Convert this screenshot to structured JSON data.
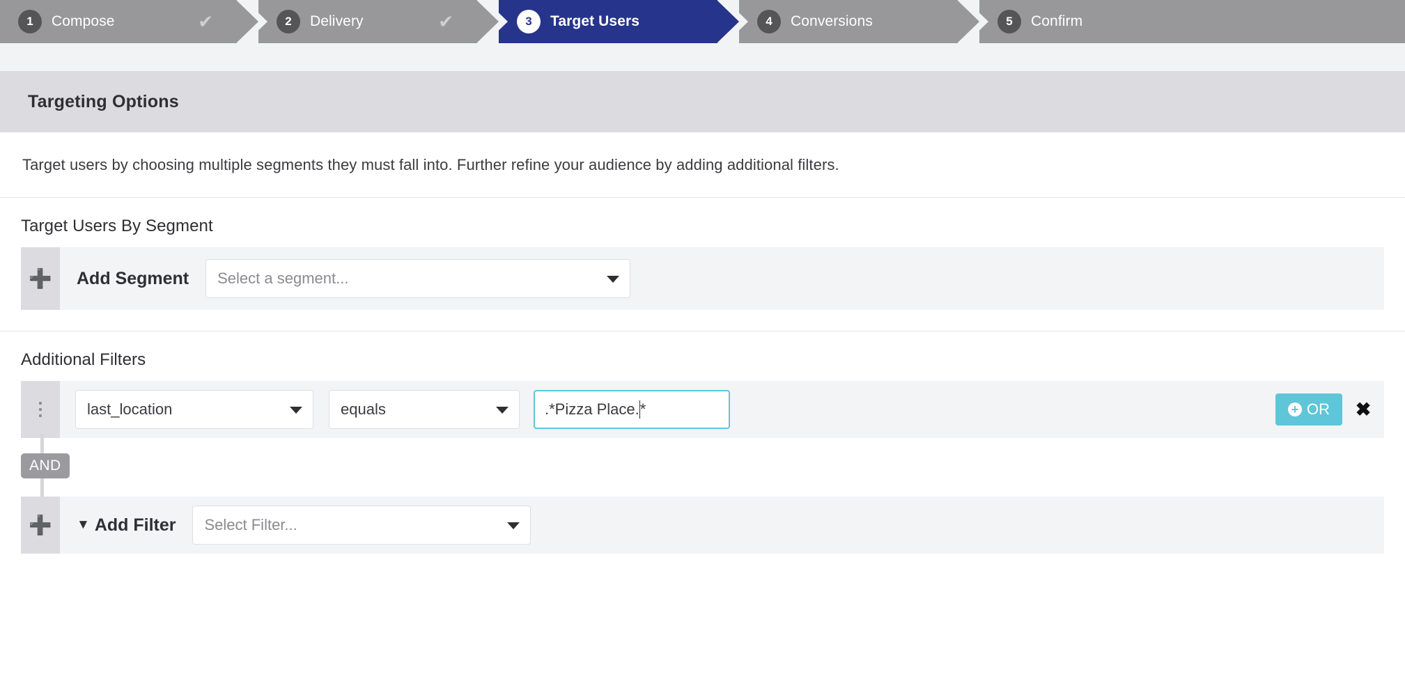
{
  "stepper": {
    "steps": [
      {
        "number": "1",
        "label": "Compose",
        "state": "complete",
        "check": "✔"
      },
      {
        "number": "2",
        "label": "Delivery",
        "state": "complete",
        "check": "✔"
      },
      {
        "number": "3",
        "label": "Target Users",
        "state": "active",
        "check": ""
      },
      {
        "number": "4",
        "label": "Conversions",
        "state": "upcoming",
        "check": ""
      },
      {
        "number": "5",
        "label": "Confirm",
        "state": "upcoming",
        "check": ""
      }
    ]
  },
  "panel": {
    "header_title": "Targeting Options",
    "description": "Target users by choosing multiple segments they must fall into. Further refine your audience by adding additional filters."
  },
  "segment_section": {
    "title": "Target Users By Segment",
    "add_label": "Add Segment",
    "add_icon": "plus-icon",
    "select_placeholder": "Select a segment...",
    "select_value": ""
  },
  "filters_section": {
    "title": "Additional Filters",
    "rows": [
      {
        "handle_icon": "drag-handle-icon",
        "attribute": "last_location",
        "operator": "equals",
        "value": ".*Pizza Place.",
        "value_tail": "*",
        "or_label": "OR",
        "or_icon": "plus-circle-icon",
        "remove_icon": "close-icon",
        "remove_glyph": "✖"
      }
    ],
    "conjunction": "AND",
    "add_label": "Add Filter",
    "add_icon": "plus-icon",
    "add_funnel_icon": "funnel-icon",
    "add_funnel_glyph": "▼",
    "add_select_placeholder": "Select Filter..."
  },
  "colors": {
    "active_step": "#27348b",
    "inactive_step": "#98989a",
    "accent_teal": "#5ec6d8",
    "header_band": "#dcdce0",
    "row_bg": "#f3f4f6",
    "handle_bg": "#dcdce0",
    "and_chip": "#9a9a9f"
  }
}
